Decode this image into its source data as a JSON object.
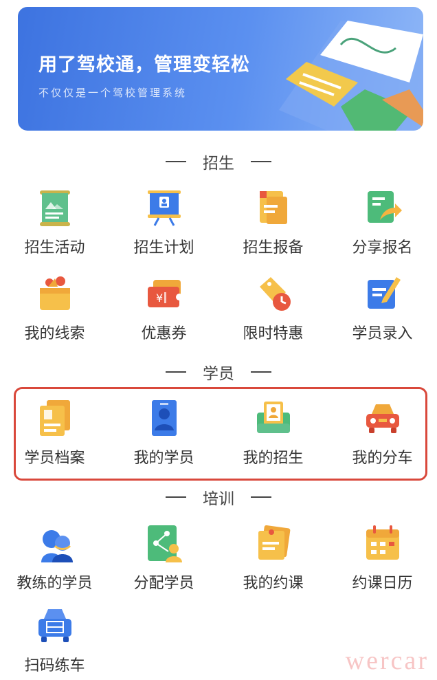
{
  "banner": {
    "title": "用了驾校通，管理变轻松",
    "subtitle": "不仅仅是一个驾校管理系统"
  },
  "sections": {
    "enrollment": "招生",
    "students": "学员",
    "training": "培训"
  },
  "enrollment_items": [
    {
      "label": "招生活动",
      "icon": "scroll-poster-icon"
    },
    {
      "label": "招生计划",
      "icon": "presentation-board-icon"
    },
    {
      "label": "招生报备",
      "icon": "document-folder-icon"
    },
    {
      "label": "分享报名",
      "icon": "share-document-icon"
    },
    {
      "label": "我的线索",
      "icon": "gift-basket-icon"
    },
    {
      "label": "优惠券",
      "icon": "coupon-icon"
    },
    {
      "label": "限时特惠",
      "icon": "price-tag-clock-icon"
    },
    {
      "label": "学员录入",
      "icon": "pencil-card-icon"
    }
  ],
  "student_items": [
    {
      "label": "学员档案",
      "icon": "student-file-icon"
    },
    {
      "label": "我的学员",
      "icon": "id-badge-icon"
    },
    {
      "label": "我的招生",
      "icon": "enrollment-profile-icon"
    },
    {
      "label": "我的分车",
      "icon": "car-icon"
    }
  ],
  "training_items": [
    {
      "label": "教练的学员",
      "icon": "coach-avatar-icon"
    },
    {
      "label": "分配学员",
      "icon": "assign-network-icon"
    },
    {
      "label": "我的约课",
      "icon": "sticky-note-icon"
    },
    {
      "label": "约课日历",
      "icon": "calendar-icon"
    },
    {
      "label": "扫码练车",
      "icon": "scan-car-icon"
    }
  ],
  "watermark": "wercar",
  "colors": {
    "banner_start": "#3d73e0",
    "banner_end": "#8fb7f7",
    "highlight_border": "#d9483b",
    "icon_blue": "#3c7be8",
    "icon_yellow": "#f6c04a",
    "icon_green": "#4dbb7a",
    "icon_red": "#e8583f"
  }
}
